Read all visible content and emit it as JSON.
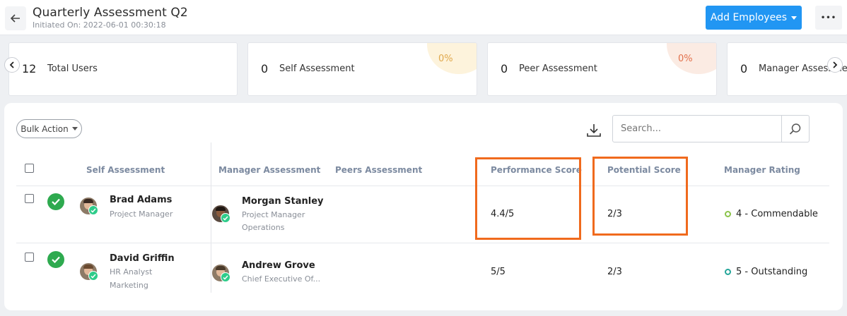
{
  "header": {
    "title": "Quarterly Assessment Q2",
    "subtitle": "Initiated On: 2022-06-01 00:30:18",
    "add_button_label": "Add Employees",
    "more_label": "•••"
  },
  "summary_cards": [
    {
      "count": "12",
      "label": "Total Users"
    },
    {
      "count": "0",
      "label": "Self Assessment",
      "percent": "0%"
    },
    {
      "count": "0",
      "label": "Peer Assessment",
      "percent": "0%"
    },
    {
      "count": "0",
      "label": "Manager Assessment"
    }
  ],
  "toolbar": {
    "bulk_action_label": "Bulk Action",
    "search_placeholder": "Search..."
  },
  "table": {
    "columns": [
      "Self Assessment",
      "Manager Assessment",
      "Peers Assessment",
      "Performance Score",
      "Potential Score",
      "Manager Rating"
    ],
    "rows": [
      {
        "employee_name": "Brad Adams",
        "employee_title": "Project Manager",
        "employee_dept": "",
        "manager_name": "Morgan Stanley",
        "manager_title": "Project Manager",
        "manager_dept": "Operations",
        "performance_score": "4.4/5",
        "potential_score": "2/3",
        "rating_number": "4",
        "rating_label": "Commendable",
        "rating_color": "#8bc34a"
      },
      {
        "employee_name": "David Griffin",
        "employee_title": "HR Analyst",
        "employee_dept": "Marketing",
        "manager_name": "Andrew Grove",
        "manager_title": "Chief Executive Of...",
        "manager_dept": "",
        "performance_score": "5/5",
        "potential_score": "2/3",
        "rating_number": "5",
        "rating_label": "Outstanding",
        "rating_color": "#26a69a"
      }
    ]
  },
  "colors": {
    "accent": "#2196f3",
    "highlight": "#f06a1d",
    "self_pct_bg": "#fdf3dc",
    "self_pct_text": "#e0a84b",
    "peer_pct_bg": "#fbebe3",
    "peer_pct_text": "#e2704b"
  }
}
